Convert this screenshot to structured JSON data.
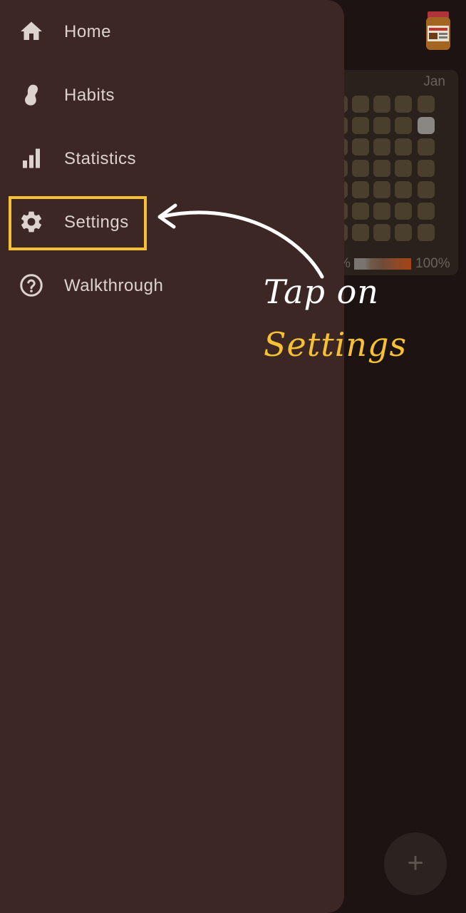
{
  "background": {
    "heatmap": {
      "month_label": "Jan",
      "legend_min_fragment": "%",
      "legend_max": "100%"
    },
    "fab_label": "+"
  },
  "drawer": {
    "items": [
      {
        "label": "Home",
        "icon": "home-icon"
      },
      {
        "label": "Habits",
        "icon": "habits-icon"
      },
      {
        "label": "Statistics",
        "icon": "bar-chart-icon"
      },
      {
        "label": "Settings",
        "icon": "gear-icon",
        "highlighted": true
      },
      {
        "label": "Walkthrough",
        "icon": "help-circle-icon"
      }
    ]
  },
  "annotation": {
    "line1": "Tap on",
    "line2": "Settings"
  },
  "colors": {
    "drawer_bg": "#3d2725",
    "screen_bg": "#1c1312",
    "highlight": "#f6c234",
    "text": "#dcd2ce"
  }
}
